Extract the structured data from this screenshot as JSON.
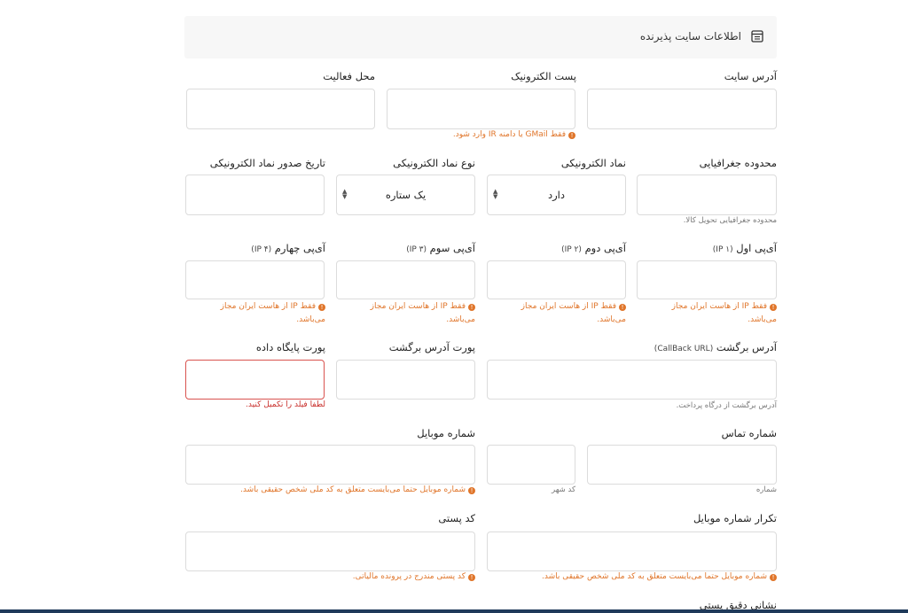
{
  "header": {
    "title": "اطلاعات سایت پذیرنده",
    "icon": "table-icon"
  },
  "labels": {
    "site_address": "آدرس سایت",
    "email": "پست الکترونیک",
    "activity_location": "محل فعالیت",
    "geo_range": "محدوده جغرافیایی",
    "e_symbol": "نماد الکترونیکی",
    "e_symbol_type": "نوع نماد الکترونیکی",
    "e_symbol_date": "تاریخ صدور نماد الکترونیکی",
    "ip1": "آی‌پی اول",
    "ip1_sub": "(IP ۱)",
    "ip2": "آی‌پی دوم",
    "ip2_sub": "(IP ۲)",
    "ip3": "آی‌پی سوم",
    "ip3_sub": "(IP ۳)",
    "ip4": "آی‌پی چهارم",
    "ip4_sub": "(IP ۴)",
    "callback": "آدرس برگشت",
    "callback_sub": "(CallBack URL)",
    "callback_port": "پورت آدرس برگشت",
    "db_port": "پورت پایگاه داده",
    "phone": "شماره تماس",
    "mobile": "شماره موبایل",
    "mobile_repeat": "تکرار شماره موبایل",
    "postal_code": "کد پستی",
    "exact_address": "نشانی دقیق پستی"
  },
  "selects": {
    "e_symbol_value": "دارد",
    "e_symbol_type_value": "یک ستاره"
  },
  "hints": {
    "email": "فقط GMail یا دامنه IR وارد شود.",
    "ip_line1": "فقط IP از هاست ایران مجاز",
    "ip_line2": "می‌باشد.",
    "mobile": "شماره موبایل حتما می‌بایست متعلق به کد ملی شخص حقیقی باشد.",
    "mobile_repeat": "شماره موبایل حتما می‌بایست متعلق به کد ملی شخص حقیقی باشد.",
    "postal_code": "کد پستی مندرج در پرونده مالیاتی."
  },
  "help": {
    "geo_range": "محدوده جغرافیایی تحویل کالا.",
    "callback": "آدرس برگشت از درگاه پرداخت.",
    "phone_number": "شماره",
    "city_code": "کد شهر"
  },
  "errors": {
    "db_port": "لطفا فیلد را تکمیل کنید."
  },
  "colors": {
    "hint": "#e0752a",
    "error": "#c9302c",
    "bar": "#1f3a5a"
  }
}
